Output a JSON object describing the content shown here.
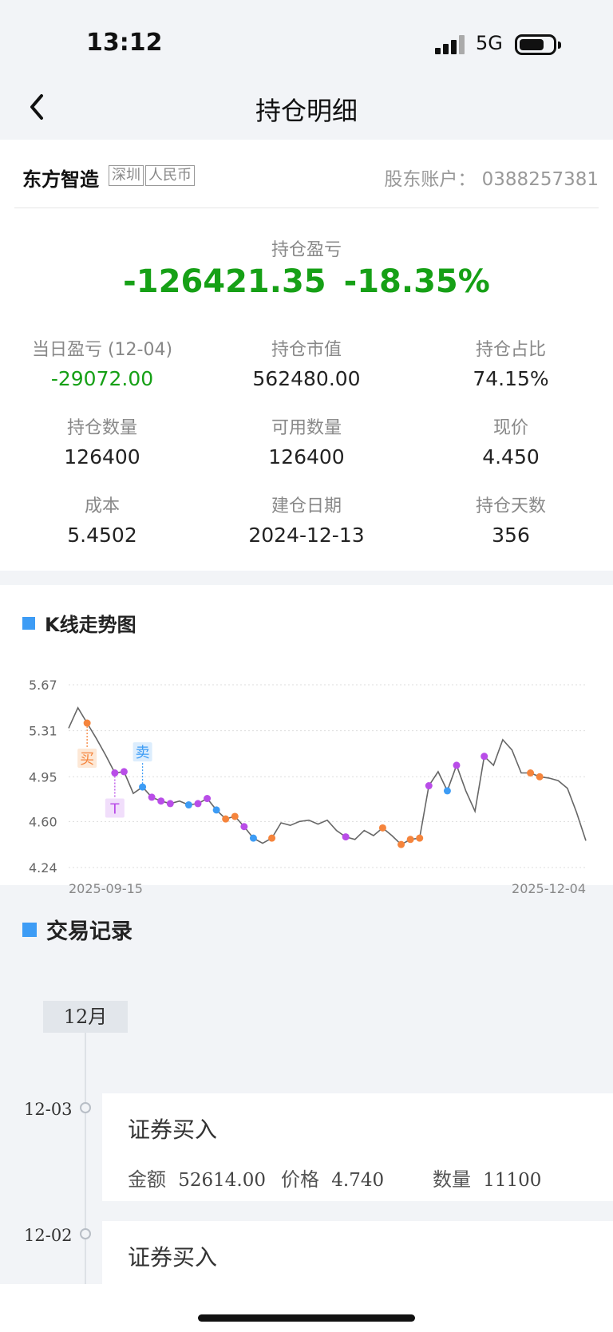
{
  "status": {
    "time": "13:12",
    "network": "5G"
  },
  "nav": {
    "title": "持仓明细"
  },
  "stock": {
    "name": "东方智造",
    "tags": [
      "深圳",
      "人民币"
    ],
    "account_label": "股东账户：",
    "account": "0388257381"
  },
  "pl": {
    "label": "持仓盈亏",
    "amount": "-126421.35",
    "percent": "-18.35%"
  },
  "stats": [
    {
      "label": "当日盈亏 (12-04)",
      "value": "-29072.00"
    },
    {
      "label": "持仓市值",
      "value": "562480.00"
    },
    {
      "label": "持仓占比",
      "value": "74.15%"
    },
    {
      "label": "持仓数量",
      "value": "126400"
    },
    {
      "label": "可用数量",
      "value": "126400"
    },
    {
      "label": "现价",
      "value": "4.450"
    },
    {
      "label": "成本",
      "value": "5.4502"
    },
    {
      "label": "建仓日期",
      "value": "2024-12-13"
    },
    {
      "label": "持仓天数",
      "value": "356"
    }
  ],
  "chart_section": {
    "title": "K线走势图"
  },
  "chart_data": {
    "type": "line",
    "title": "K线走势图",
    "yticks": [
      "5.67",
      "5.31",
      "4.95",
      "4.60",
      "4.24"
    ],
    "ylim": [
      4.24,
      5.67
    ],
    "grid": true,
    "x_start_label": "2025-09-15",
    "x_end_label": "2025-12-04",
    "values": [
      5.33,
      5.49,
      5.37,
      5.25,
      5.12,
      4.98,
      4.99,
      4.82,
      4.87,
      4.79,
      4.76,
      4.74,
      4.76,
      4.73,
      4.74,
      4.78,
      4.69,
      4.62,
      4.64,
      4.56,
      4.47,
      4.43,
      4.47,
      4.59,
      4.57,
      4.6,
      4.61,
      4.58,
      4.61,
      4.53,
      4.48,
      4.46,
      4.53,
      4.49,
      4.55,
      4.49,
      4.42,
      4.46,
      4.47,
      4.88,
      4.99,
      4.84,
      5.04,
      4.84,
      4.68,
      5.11,
      5.04,
      5.24,
      5.16,
      4.98,
      4.98,
      4.95,
      4.94,
      4.92,
      4.86,
      4.67,
      4.45
    ],
    "markers": [
      {
        "i": 2,
        "color": "#f5843c"
      },
      {
        "i": 5,
        "color": "#b94de8"
      },
      {
        "i": 6,
        "color": "#b94de8"
      },
      {
        "i": 8,
        "color": "#3d9cf5"
      },
      {
        "i": 9,
        "color": "#b94de8"
      },
      {
        "i": 10,
        "color": "#b94de8"
      },
      {
        "i": 11,
        "color": "#b94de8"
      },
      {
        "i": 13,
        "color": "#3d9cf5"
      },
      {
        "i": 14,
        "color": "#b94de8"
      },
      {
        "i": 15,
        "color": "#b94de8"
      },
      {
        "i": 16,
        "color": "#3d9cf5"
      },
      {
        "i": 17,
        "color": "#f5843c"
      },
      {
        "i": 18,
        "color": "#f5843c"
      },
      {
        "i": 19,
        "color": "#b94de8"
      },
      {
        "i": 20,
        "color": "#3d9cf5"
      },
      {
        "i": 22,
        "color": "#f5843c"
      },
      {
        "i": 30,
        "color": "#b94de8"
      },
      {
        "i": 34,
        "color": "#f5843c"
      },
      {
        "i": 36,
        "color": "#f5843c"
      },
      {
        "i": 37,
        "color": "#f5843c"
      },
      {
        "i": 38,
        "color": "#f5843c"
      },
      {
        "i": 39,
        "color": "#b94de8"
      },
      {
        "i": 41,
        "color": "#3d9cf5"
      },
      {
        "i": 42,
        "color": "#b94de8"
      },
      {
        "i": 45,
        "color": "#b94de8"
      },
      {
        "i": 50,
        "color": "#f5843c"
      },
      {
        "i": 51,
        "color": "#f5843c"
      }
    ],
    "annotations": [
      {
        "text": "买",
        "i": 2,
        "color": "#f5843c",
        "bg": "#fde8d6"
      },
      {
        "text": "T",
        "i": 5,
        "color": "#b94de8",
        "bg": "#f1defb"
      },
      {
        "text": "卖",
        "i": 8,
        "color": "#3d9cf5",
        "bg": "#dcedfd"
      }
    ]
  },
  "trades": {
    "title": "交易记录",
    "month": "12月",
    "labels": {
      "amount": "金额",
      "price": "价格",
      "qty": "数量"
    },
    "records": [
      {
        "date": "12-03",
        "type": "证券买入",
        "amount": "52614.00",
        "price": "4.740",
        "qty": "11100"
      },
      {
        "date": "12-02",
        "type": "证券买入",
        "amount": "",
        "price": "",
        "qty": ""
      }
    ]
  }
}
